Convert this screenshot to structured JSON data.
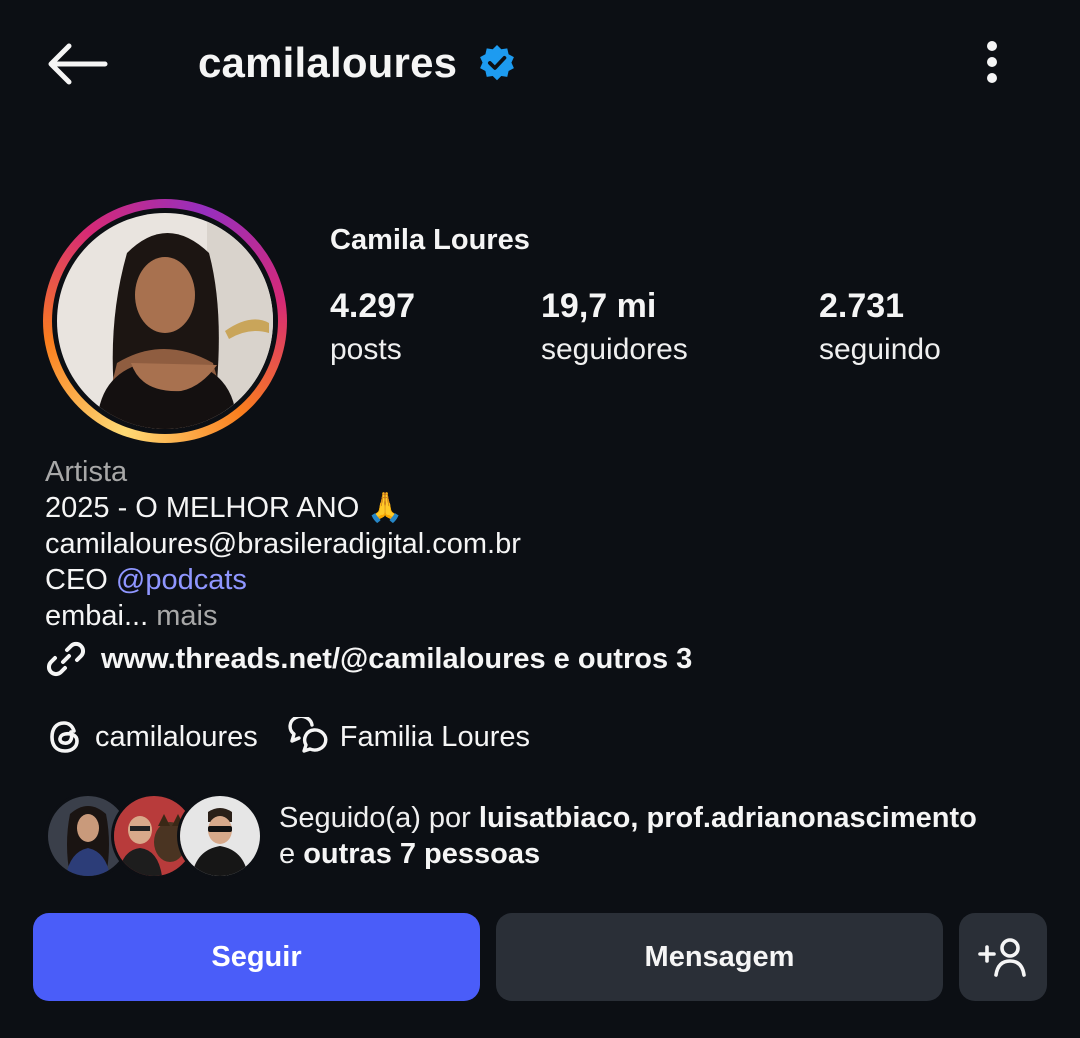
{
  "header": {
    "username": "camilaloures",
    "back_icon": "arrow-left-icon",
    "verified_icon": "verified-badge-icon",
    "more_icon": "three-dots-vertical-icon"
  },
  "profile": {
    "display_name": "Camila Loures",
    "stats": [
      {
        "value": "4.297",
        "label": "posts"
      },
      {
        "value": "19,7 mi",
        "label": "seguidores"
      },
      {
        "value": "2.731",
        "label": "seguindo"
      }
    ]
  },
  "bio": {
    "category": "Artista",
    "line1": "2025 - O MELHOR ANO 🙏",
    "line2": "camilaloures@brasileradigital.com.br",
    "line3_prefix": "CEO ",
    "line3_mention": "@podcats",
    "line4_text": "embai... ",
    "line4_more": "mais",
    "link_text": "www.threads.net/@camilaloures e outros 3"
  },
  "chips": [
    {
      "icon": "threads-icon",
      "label": "camilaloures"
    },
    {
      "icon": "community-chat-icon",
      "label": "Familia Loures"
    }
  ],
  "followed_by": {
    "prefix": "Seguido(a) por ",
    "user1": "luisatbiaco",
    "sep": ", ",
    "user2": "prof.adrianonascimento",
    "line2_prefix": "e ",
    "others": "outras 7 pessoas"
  },
  "actions": {
    "follow_label": "Seguir",
    "message_label": "Mensagem",
    "suggest_icon": "add-person-icon"
  },
  "colors": {
    "background": "#0c0f14",
    "primary_button": "#4a5df9",
    "secondary_button": "#2a2f37",
    "mention": "#8f96ff",
    "verified": "#1d9bf0"
  }
}
